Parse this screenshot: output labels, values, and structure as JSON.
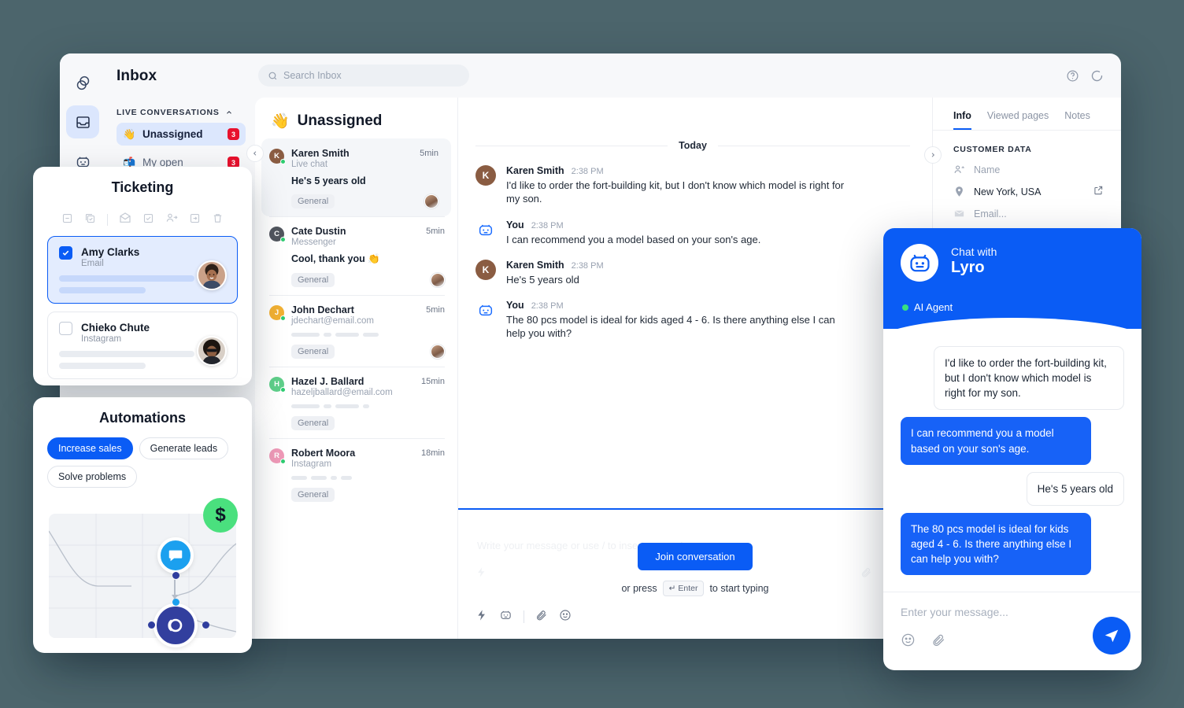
{
  "theme": {
    "bg": "#4c656c",
    "accent": "#0a5cf5",
    "danger": "#e8112d",
    "online": "#2ecc71",
    "money": "#4ae07e"
  },
  "app": {
    "rail": [
      {
        "name": "brand-logo-icon",
        "label": "Tidio"
      },
      {
        "name": "inbox-icon",
        "label": "Inbox",
        "active": true
      },
      {
        "name": "lyro-bot-icon",
        "label": "Lyro AI"
      }
    ],
    "sidebar": {
      "title": "Inbox",
      "section_label": "LIVE CONVERSATIONS",
      "items": [
        {
          "emoji": "👋",
          "label": "Unassigned",
          "count": "3",
          "active": true
        },
        {
          "emoji": "📬",
          "label": "My open",
          "count": "3",
          "active": false
        }
      ]
    },
    "topbar": {
      "search_placeholder": "Search Inbox",
      "help_icon": "help-circle-icon",
      "refresh_icon": "refresh-spinner-icon"
    },
    "conversation_list": {
      "header_emoji": "👋",
      "header_title": "Unassigned",
      "items": [
        {
          "initial": "K",
          "avatar_color": "#8a5c42",
          "name": "Karen Smith",
          "channel": "Live chat",
          "time": "5min",
          "snippet": "He's 5 years old",
          "tag": "General",
          "selected": true,
          "has_assignee": true,
          "skeleton": []
        },
        {
          "initial": "C",
          "avatar_color": "#51565e",
          "name": "Cate Dustin",
          "channel": "Messenger",
          "time": "5min",
          "snippet": "Cool, thank you 👏",
          "tag": "General",
          "selected": false,
          "has_assignee": true,
          "skeleton": []
        },
        {
          "initial": "J",
          "avatar_color": "#f2b133",
          "name": "John Dechart",
          "channel": "jdechart@email.com",
          "time": "5min",
          "snippet": "",
          "tag": "General",
          "selected": false,
          "has_assignee": true,
          "skeleton": [
            36,
            10,
            30,
            20
          ]
        },
        {
          "initial": "H",
          "avatar_color": "#5fcf8a",
          "name": "Hazel J. Ballard",
          "channel": "hazeljballard@email.com",
          "time": "15min",
          "snippet": "",
          "tag": "General",
          "selected": false,
          "has_assignee": false,
          "skeleton": [
            36,
            10,
            30,
            8
          ]
        },
        {
          "initial": "R",
          "avatar_color": "#ef9ab8",
          "name": "Robert Moora",
          "channel": "Instagram",
          "time": "18min",
          "snippet": "",
          "tag": "General",
          "selected": false,
          "has_assignee": false,
          "skeleton": [
            20,
            20,
            8,
            14
          ]
        }
      ]
    },
    "conversation_detail": {
      "day_separator": "Today",
      "messages": [
        {
          "author": "Karen Smith",
          "time": "2:38 PM",
          "text": "I'd like to order the fort-building kit, but I don't know which model is right for my son.",
          "avatar": "K",
          "avatar_color": "#8a5c42",
          "is_bot": false
        },
        {
          "author": "You",
          "time": "2:38 PM",
          "text": "I can recommend you a model based on your son's age.",
          "avatar": "",
          "avatar_color": "",
          "is_bot": true
        },
        {
          "author": "Karen Smith",
          "time": "2:38 PM",
          "text": "He's 5 years old",
          "avatar": "K",
          "avatar_color": "#8a5c42",
          "is_bot": false
        },
        {
          "author": "You",
          "time": "2:38 PM",
          "text": "The 80 pcs model is ideal for kids aged 4 - 6. Is there anything else I can help you with?",
          "avatar": "",
          "avatar_color": "",
          "is_bot": true
        }
      ],
      "composer": {
        "ghost_placeholder": "Write your message or use / to insert a saved response",
        "join_button": "Join conversation",
        "hint_prefix": "or press",
        "hint_key": "↵ Enter",
        "hint_suffix": "to start typing",
        "tools": [
          "lightning-icon",
          "bot-icon",
          "attachment-icon",
          "emoji-icon"
        ]
      }
    },
    "info_panel": {
      "tabs": [
        {
          "label": "Info",
          "active": true
        },
        {
          "label": "Viewed pages",
          "active": false
        },
        {
          "label": "Notes",
          "active": false
        }
      ],
      "section_title": "CUSTOMER DATA",
      "rows": [
        {
          "icon": "person-add-icon",
          "value": "Name",
          "placeholder": true,
          "external": false
        },
        {
          "icon": "location-pin-icon",
          "value": "New York, USA",
          "placeholder": false,
          "external": true
        },
        {
          "icon": "envelope-icon",
          "value": "Email...",
          "placeholder": true,
          "external": false
        }
      ]
    }
  },
  "ticketing_card": {
    "title": "Ticketing",
    "toolbar": [
      "minus-box-icon",
      "copy-check-icon",
      "mail-open-icon",
      "check-box-icon",
      "assign-user-icon",
      "move-to-icon",
      "trash-icon"
    ],
    "tickets": [
      {
        "name": "Amy Clarks",
        "channel": "Email",
        "checked": true
      },
      {
        "name": "Chieko Chute",
        "channel": "Instagram",
        "checked": false
      }
    ]
  },
  "automations_card": {
    "title": "Automations",
    "chips": [
      {
        "label": "Increase sales",
        "active": true
      },
      {
        "label": "Generate leads",
        "active": false
      },
      {
        "label": "Solve problems",
        "active": false
      }
    ],
    "money_symbol": "$",
    "nodes": [
      "chat-bubble-node-icon",
      "bot-node-icon"
    ]
  },
  "lyro_widget": {
    "header_sub": "Chat with",
    "header_name": "Lyro",
    "status": "AI Agent",
    "avatar_icon": "lyro-bot-icon",
    "messages": [
      {
        "from": "user",
        "text": "I'd like to order the fort-building kit, but I don't know which model is right for my son."
      },
      {
        "from": "bot",
        "text": "I can recommend you a model based on your son's age."
      },
      {
        "from": "user",
        "text": "He's 5 years old"
      },
      {
        "from": "bot",
        "text": "The 80 pcs model is ideal for kids aged 4 - 6. Is there anything else I can help you with?"
      }
    ],
    "input_placeholder": "Enter your message...",
    "footer_icons": [
      "emoji-icon",
      "attachment-icon"
    ],
    "send_icon": "send-icon"
  }
}
